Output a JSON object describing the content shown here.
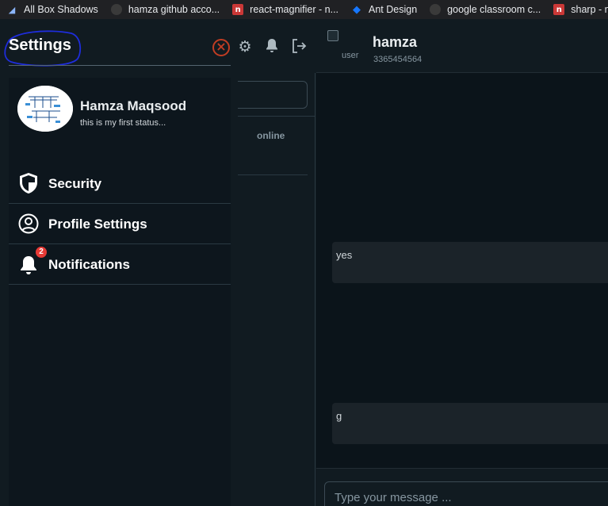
{
  "bookmarks": [
    {
      "label": "All Box Shadows",
      "icon": "box-shadows-icon"
    },
    {
      "label": "hamza github acco...",
      "icon": "github-icon"
    },
    {
      "label": "react-magnifier - n...",
      "icon": "npm-icon"
    },
    {
      "label": "Ant Design",
      "icon": "ant-design-icon"
    },
    {
      "label": "google classroom c...",
      "icon": "github-icon"
    },
    {
      "label": "sharp - np",
      "icon": "npm-icon"
    }
  ],
  "sidebar_list": {
    "online_label": "online"
  },
  "chat": {
    "contact_name": "hamza",
    "contact_phone": "3365454564",
    "avatar_alt": "user",
    "messages": [
      {
        "text": "yes"
      },
      {
        "text": "g"
      }
    ],
    "composer_placeholder": "Type your message ..."
  },
  "settings": {
    "title": "Settings",
    "profile": {
      "name": "Hamza Maqsood",
      "status": "this is my first status..."
    },
    "menu": [
      {
        "label": "Security",
        "icon": "shield-icon"
      },
      {
        "label": "Profile Settings",
        "icon": "user-circle-icon"
      },
      {
        "label": "Notifications",
        "icon": "bell-icon",
        "badge": "2"
      }
    ],
    "colors": {
      "close_accent": "#c13d23",
      "badge": "#e53935",
      "annotation_circle": "#1e2ddb"
    }
  }
}
